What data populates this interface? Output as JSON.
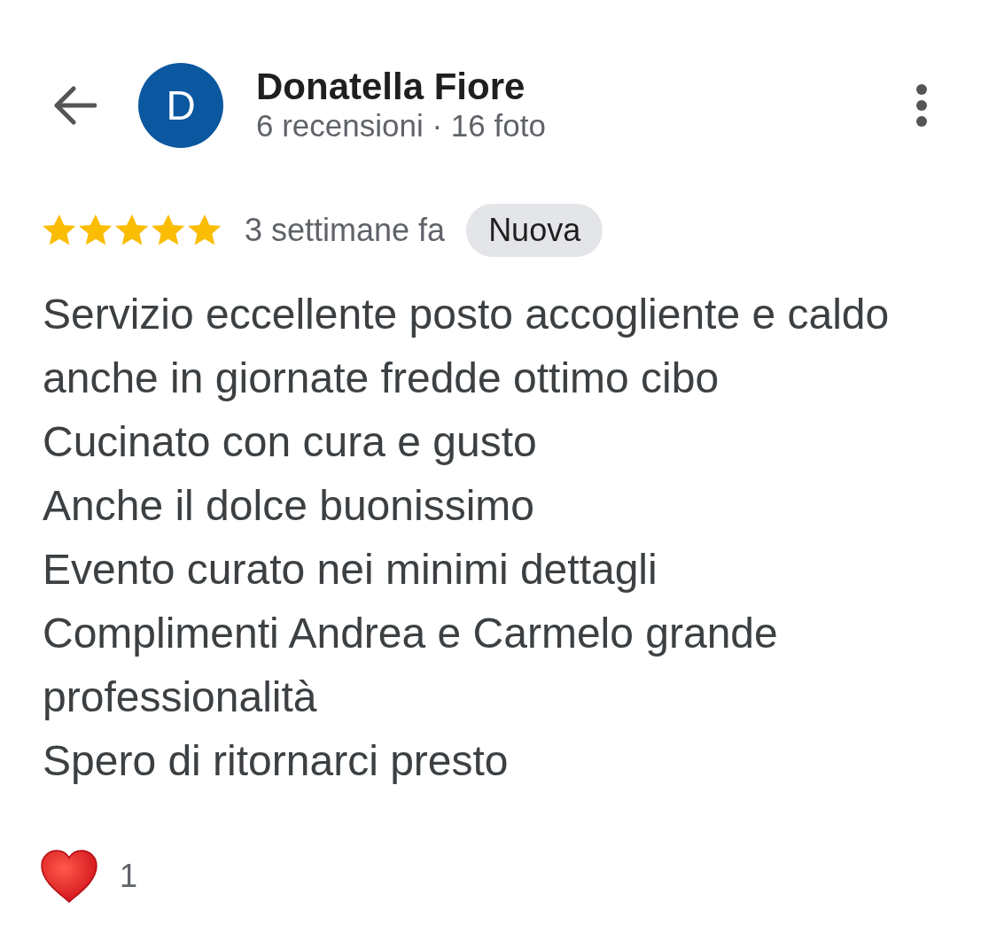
{
  "header": {
    "avatar_letter": "D",
    "author_name": "Donatella Fiore",
    "author_stats": "6 recensioni · 16 foto"
  },
  "review": {
    "stars": 5,
    "time": "3 settimane fa",
    "badge": "Nuova",
    "text": "Servizio eccellente posto accogliente e caldo anche in giornate fredde ottimo cibo\nCucinato con cura e gusto\nAnche il dolce buonissimo\nEvento curato nei minimi dettagli\nComplimenti Andrea e Carmelo grande professionalità\nSpero di ritornarci presto"
  },
  "reaction": {
    "count": "1"
  }
}
